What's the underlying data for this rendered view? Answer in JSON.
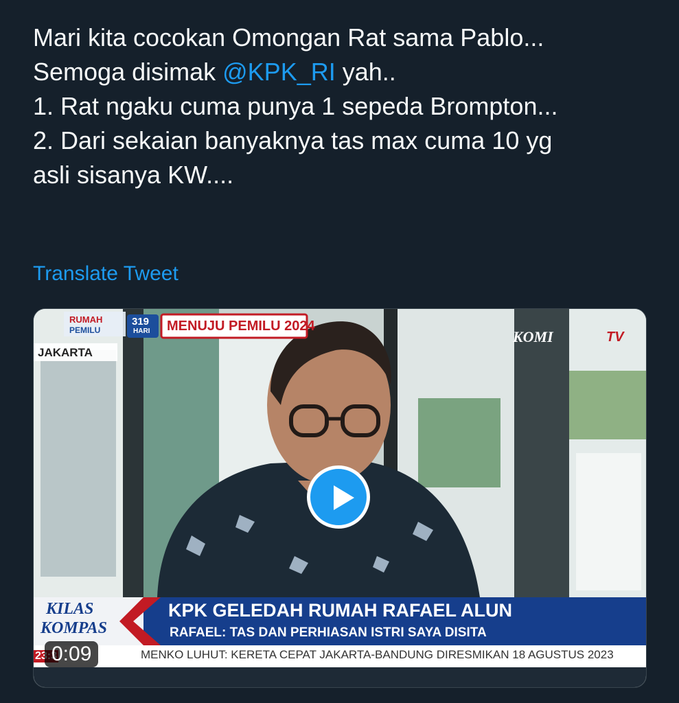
{
  "tweet": {
    "lines": [
      {
        "before": "Mari kita cocokan Omongan Rat sama Pablo...",
        "mention": "",
        "after": ""
      },
      {
        "before": "Semoga disimak ",
        "mention": "@KPK_RI",
        "after": " yah.."
      },
      {
        "before": "1. Rat ngaku cuma punya 1 sepeda Brompton...",
        "mention": "",
        "after": ""
      },
      {
        "before": "2. Dari sekaian banyaknya tas max cuma 10 yg",
        "mention": "",
        "after": ""
      },
      {
        "before": "asli sisanya KW....",
        "mention": "",
        "after": ""
      }
    ],
    "translate_label": "Translate Tweet"
  },
  "video": {
    "duration": "0:09",
    "broadcast": {
      "badge_top": "RUMAH",
      "badge_bottom": "PEMILU",
      "days_count": "319",
      "days_label": "HARI",
      "event_banner": "MENUJU PEMILU 2024",
      "location": "JAKARTA",
      "channel_left": "KOMI",
      "channel_right": "TV",
      "segment_line1": "KILAS",
      "segment_line2": "KOMPAS",
      "headline": "KPK GELEDAH RUMAH RAFAEL ALUN",
      "subheadline": "RAFAEL: TAS DAN PERHIASAN ISTRI SAYA DISITA",
      "ticker": "MENKO LUHUT: KERETA CEPAT JAKARTA-BANDUNG DIRESMIKAN 18 AGUSTUS 2023",
      "clock_fragment": "23:3"
    }
  },
  "colors": {
    "background": "#15202b",
    "link": "#1d9bf0",
    "text": "#f7f9f9"
  }
}
